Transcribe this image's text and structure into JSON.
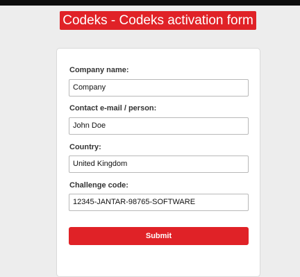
{
  "header": {
    "title": "Codeks - Codeks activation form"
  },
  "form": {
    "company_label": "Company name:",
    "company_value": "Company",
    "contact_label": "Contact e-mail / person:",
    "contact_value": "John Doe",
    "country_label": "Country:",
    "country_value": "United Kingdom",
    "challenge_label": "Challenge code:",
    "challenge_value": "12345-JANTAR-98765-SOFTWARE",
    "submit_label": "Submit"
  },
  "colors": {
    "accent": "#e02227",
    "background": "#ededed",
    "topbar": "#0d0d0d"
  }
}
